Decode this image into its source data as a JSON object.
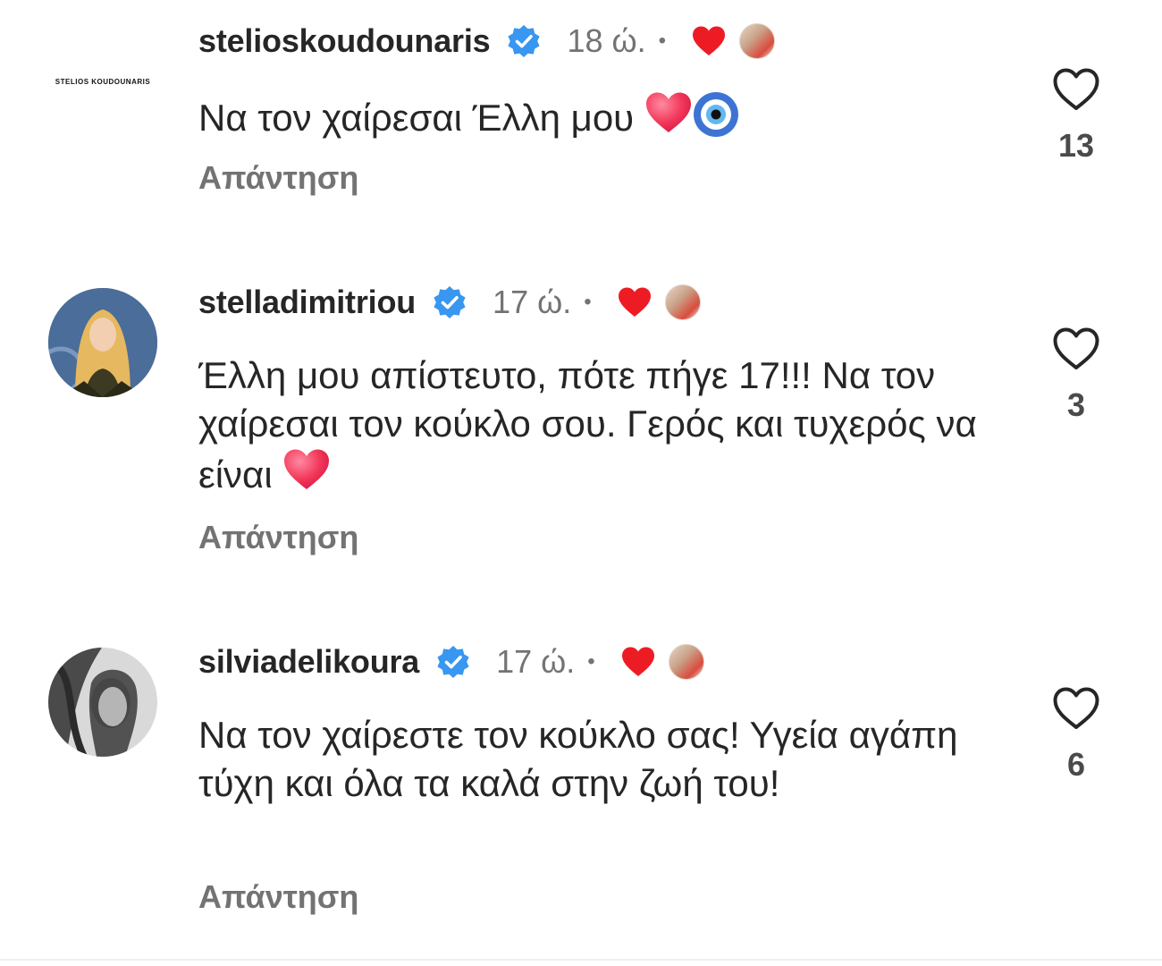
{
  "comments": [
    {
      "username": "stelioskoudounaris",
      "avatar_text": "STELIOS   KOUDOUNARIS",
      "time": "18 ώ.",
      "dot": "•",
      "text": "Να τον χαίρεσαι Έλλη μου",
      "reply_label": "Απάντηση",
      "likes": "13"
    },
    {
      "username": "stelladimitriou",
      "time": "17 ώ.",
      "dot": "•",
      "text": "Έλλη μου απίστευτο, πότε πήγε 17!!! Να τον χαίρεσαι τον κούκλο σου. Γερός και τυχερός να είναι",
      "reply_label": "Απάντηση",
      "likes": "3"
    },
    {
      "username": "silviadelikoura",
      "time": "17 ώ.",
      "dot": "•",
      "text": "Να τον χαίρεστε τον κούκλο σας! Υγεία αγάπη τύχη και όλα τα καλά στην ζωή του!",
      "reply_label": "Απάντηση",
      "likes": "6"
    }
  ],
  "colors": {
    "verified": "#3897f0",
    "creator_heart": "#ed1c24",
    "secondary_text": "#737373"
  },
  "icons": {
    "verified": "verified-badge-icon",
    "creator_like": "heart-filled-icon",
    "like": "heart-outline-icon"
  }
}
